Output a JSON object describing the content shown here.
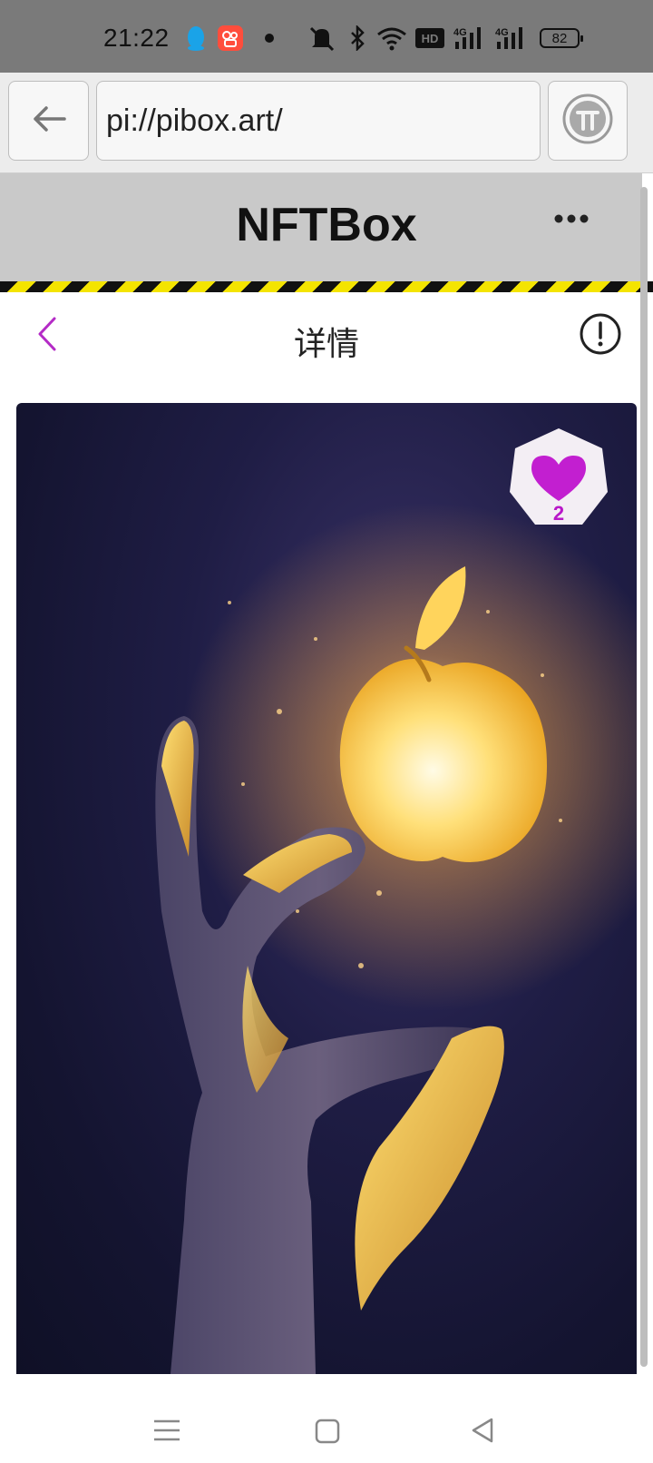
{
  "status_bar": {
    "time": "21:22",
    "battery": "82",
    "icons": [
      "qq-icon",
      "kuaishou-icon",
      "dot-icon",
      "mute-icon",
      "bluetooth-icon",
      "wifi-icon",
      "hd-icon",
      "signal-4g-icon",
      "signal-4g-icon",
      "battery-icon"
    ]
  },
  "browser": {
    "url": "pi://pibox.art/",
    "back_icon": "arrow-left-icon",
    "pi_icon": "pi-logo-icon"
  },
  "app": {
    "title": "NFTBox",
    "menu_icon": "more-dots-icon"
  },
  "detail": {
    "title": "详情",
    "back_icon": "chevron-left-icon",
    "info_icon": "info-icon"
  },
  "artwork": {
    "like_count": "2",
    "like_icon": "heart-icon",
    "accent": "#b817c8"
  },
  "nav": {
    "icons": [
      "menu-icon",
      "home-square-icon",
      "back-triangle-icon"
    ]
  }
}
